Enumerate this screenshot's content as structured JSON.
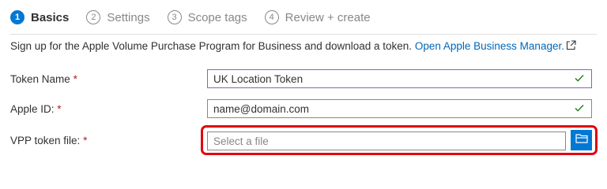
{
  "wizard": {
    "steps": [
      {
        "number": "1",
        "label": "Basics",
        "active": true
      },
      {
        "number": "2",
        "label": "Settings",
        "active": false
      },
      {
        "number": "3",
        "label": "Scope tags",
        "active": false
      },
      {
        "number": "4",
        "label": "Review + create",
        "active": false
      }
    ]
  },
  "intro": {
    "text": "Sign up for the Apple Volume Purchase Program for Business and download a token.",
    "link_label": "Open Apple Business Manager.",
    "link_icon": "external-link-icon"
  },
  "form": {
    "token_name": {
      "label": "Token Name",
      "required_mark": "*",
      "value": "UK Location Token",
      "valid": true
    },
    "apple_id": {
      "label": "Apple ID:",
      "required_mark": "*",
      "value": "name@domain.com",
      "valid": true
    },
    "vpp_file": {
      "label": "VPP token file:",
      "required_mark": "*",
      "placeholder": "Select a file",
      "browse_icon": "folder-icon"
    }
  },
  "colors": {
    "accent": "#0078d4",
    "link": "#0067b8",
    "valid_check": "#107c10",
    "required": "#a4262c",
    "highlight": "#e3000f"
  }
}
